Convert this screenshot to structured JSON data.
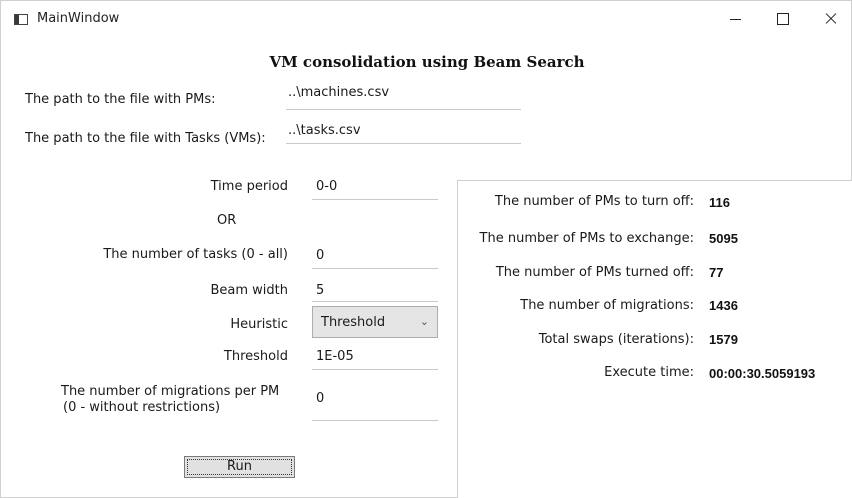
{
  "window": {
    "title": "MainWindow"
  },
  "heading": "VM consolidation using Beam Search",
  "paths": {
    "pms_label": "The path to the file with PMs:",
    "pms_value": "..\\machines.csv",
    "tasks_label": "The path to the file with Tasks (VMs):",
    "tasks_value": "..\\tasks.csv"
  },
  "params": {
    "time_period_label": "Time period",
    "time_period_value": "0-0",
    "or_label": "OR",
    "num_tasks_label": "The number of tasks (0 - all)",
    "num_tasks_value": "0",
    "beam_width_label": "Beam width",
    "beam_width_value": "5",
    "heuristic_label": "Heuristic",
    "heuristic_selected": "Threshold",
    "threshold_label": "Threshold",
    "threshold_value": "1E-05",
    "migrations_label_line1": "The number of migrations per PM",
    "migrations_label_line2": "(0 - without restrictions)",
    "migrations_value": "0"
  },
  "run_button": "Run",
  "results": {
    "turn_off_label": "The number of PMs to turn off:",
    "turn_off_value": "116",
    "exchange_label": "The number of PMs to exchange:",
    "exchange_value": "5095",
    "turned_off_label": "The number of PMs turned off:",
    "turned_off_value": "77",
    "migrations_label": "The number of migrations:",
    "migrations_value": "1436",
    "swaps_label": "Total swaps (iterations):",
    "swaps_value": "1579",
    "exec_time_label": "Execute time:",
    "exec_time_value": "00:00:30.5059193"
  },
  "icons": {
    "app": "app-window-icon",
    "minimize": "minimize-icon",
    "maximize": "maximize-icon",
    "close": "close-icon",
    "dropdown": "chevron-down-icon"
  }
}
